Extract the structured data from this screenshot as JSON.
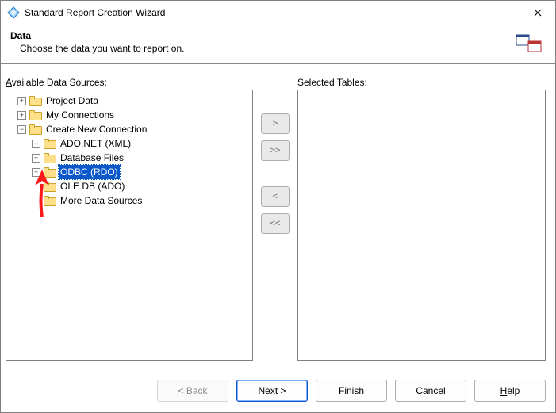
{
  "window": {
    "title": "Standard Report Creation Wizard"
  },
  "header": {
    "heading": "Data",
    "sub": "Choose the data you want to report on."
  },
  "panels": {
    "available_label_pre": "A",
    "available_label_post": "vailable Data Sources:",
    "selected_label": "Selected Tables:"
  },
  "tree": {
    "n0": {
      "label": "Project Data"
    },
    "n1": {
      "label": "My Connections"
    },
    "n2": {
      "label": "Create New Connection"
    },
    "n2_0": {
      "label": "ADO.NET (XML)"
    },
    "n2_1": {
      "label": "Database Files"
    },
    "n2_2": {
      "label": "ODBC (RDO)"
    },
    "n2_3": {
      "label": "OLE DB (ADO)"
    },
    "n2_4": {
      "label": "More Data Sources"
    }
  },
  "midButtons": {
    "add": ">",
    "addAll": ">>",
    "remove": "<",
    "removeAll": "<<"
  },
  "footer": {
    "back": "< Back",
    "next": "Next >",
    "finish": "Finish",
    "cancel": "Cancel",
    "help_pre": "H",
    "help_post": "elp"
  }
}
